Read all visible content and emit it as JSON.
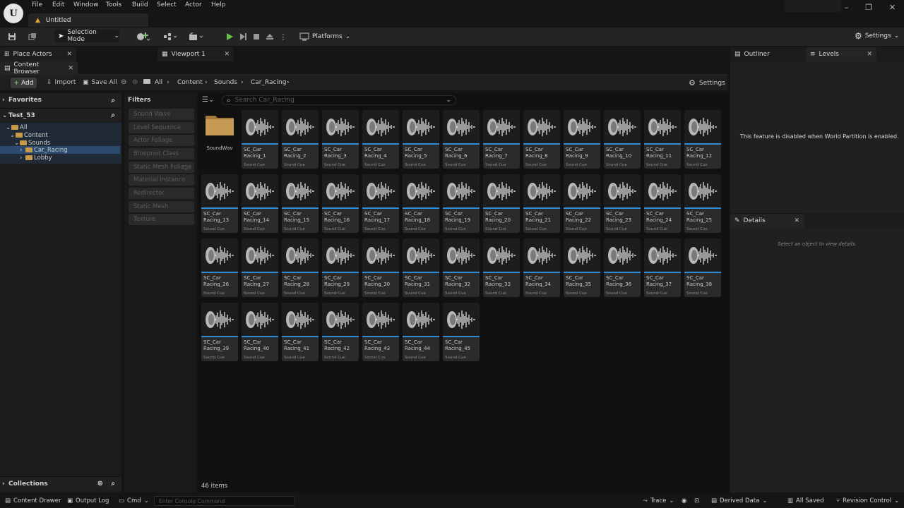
{
  "menu": [
    "File",
    "Edit",
    "Window",
    "Tools",
    "Build",
    "Select",
    "Actor",
    "Help"
  ],
  "document_tab": "Untitled",
  "toolbar": {
    "mode": "Selection Mode",
    "platforms": "Platforms",
    "settings": "Settings"
  },
  "panel_tabs": {
    "place_actors": "Place Actors",
    "viewport": "Viewport 1",
    "content_browser": "Content Browser",
    "outliner": "Outliner",
    "levels": "Levels",
    "details": "Details"
  },
  "cb_toolbar": {
    "add": "Add",
    "import": "Import",
    "save_all": "Save All",
    "breadcrumb": [
      "All",
      "Content",
      "Sounds",
      "Car_Racing"
    ],
    "settings": "Settings"
  },
  "left_panel": {
    "favorites": "Favorites",
    "project": "Test_53",
    "tree": [
      "All",
      "Content",
      "Sounds",
      "Car_Racing",
      "Lobby"
    ],
    "collections": "Collections"
  },
  "filters": {
    "title": "Filters",
    "items": [
      "Sound Wave",
      "Level Sequence",
      "Actor Foliage",
      "Blueprint Class",
      "Static Mesh Foliage",
      "Material Instance",
      "Redirector",
      "Static Mesh",
      "Texture"
    ]
  },
  "grid": {
    "search_placeholder": "Search Car_Racing",
    "folder_label": "SoundWav",
    "asset_kind": "Sound Cue",
    "asset_prefix": "SC_Car",
    "asset_count": 45,
    "items_count": "46 items"
  },
  "levels_message": "This feature is disabled when World Partition is enabled.",
  "details_message": "Select an object to view details.",
  "statusbar": {
    "content_drawer": "Content Drawer",
    "output_log": "Output Log",
    "cmd": "Cmd",
    "console_placeholder": "Enter Console Command",
    "trace": "Trace",
    "derived_data": "Derived Data",
    "all_saved": "All Saved",
    "revision_control": "Revision Control"
  }
}
